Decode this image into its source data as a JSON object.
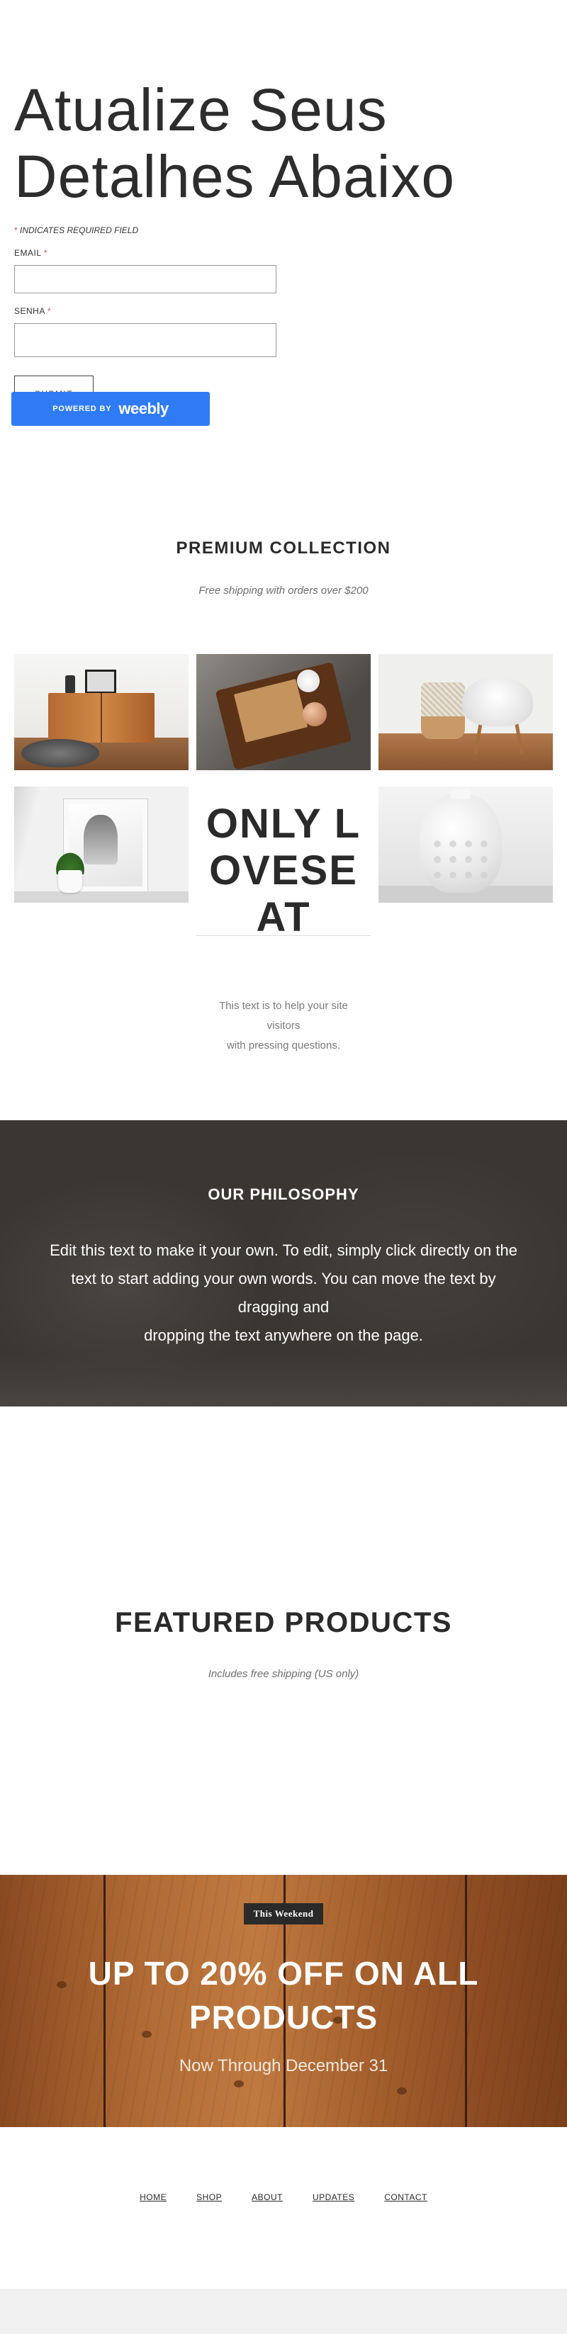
{
  "form": {
    "title": "Atualize Seus Detalhes Abaixo",
    "required_note_star": "*",
    "required_note": " INDICATES REQUIRED FIELD",
    "email_label": "EMAIL",
    "password_label": "SENHA",
    "required_star": "*",
    "email_value": "",
    "password_value": "",
    "submit_label": "SUBMIT"
  },
  "weebly_badge": {
    "powered_by": "POWERED BY",
    "brand": "weebly",
    "color": "#2f7bf5"
  },
  "premium": {
    "title": "PREMIUM COLLECTION",
    "subtitle": "Free shipping with orders over $200",
    "feature_text": "ONLY LOVESEAT",
    "help_lines": [
      "This text is to help your site",
      "visitors",
      "with pressing questions."
    ]
  },
  "philosophy": {
    "title": "OUR PHILOSOPHY",
    "lines": [
      "Edit this text to make it your own. To edit, simply click directly on the",
      "text to start adding your own words. You can move the text by",
      "dragging and",
      "dropping the text anywhere on the page."
    ]
  },
  "featured": {
    "title": "FEATURED PRODUCTS",
    "subtitle": "Includes free shipping (US only)"
  },
  "banner": {
    "tag": "This Weekend",
    "title": "UP TO 20% OFF ON ALL PRODUCTS",
    "subtitle": "Now Through December 31"
  },
  "footer": {
    "links": [
      "HOME",
      "SHOP",
      "ABOUT",
      "UPDATES",
      "CONTACT"
    ]
  },
  "colors": {
    "philosophy_bg": "#3a3733",
    "banner_wood": "#b06a34",
    "required_star": "#d9534f"
  }
}
